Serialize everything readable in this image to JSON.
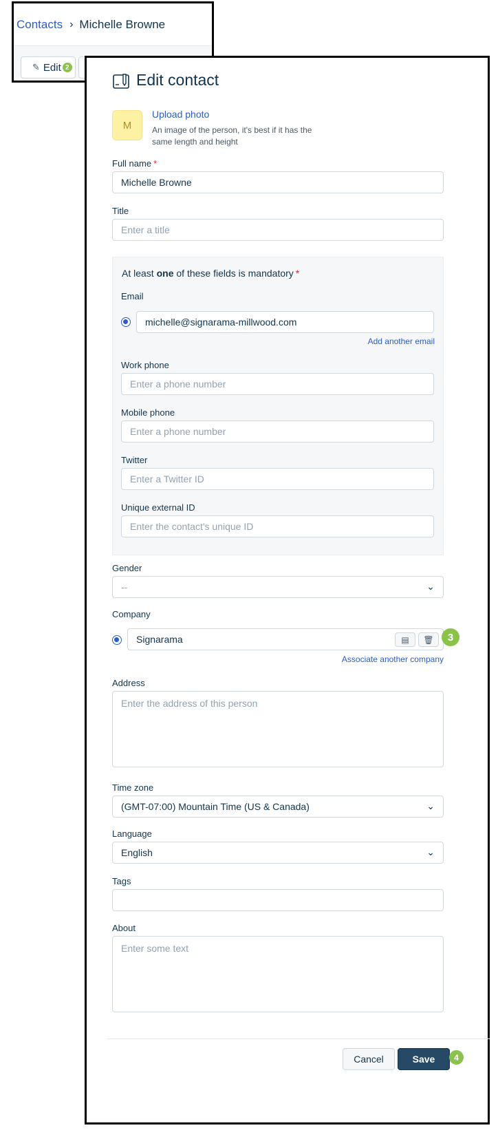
{
  "breadcrumb": {
    "parent": "Contacts",
    "separator": "›",
    "current": "Michelle Browne"
  },
  "toolbar": {
    "edit_label": "Edit",
    "edit_badge": "2"
  },
  "form": {
    "title": "Edit contact",
    "avatar_initial": "M",
    "upload_label": "Upload photo",
    "upload_hint": "An image of the person, it's best if it has the same length and height",
    "full_name": {
      "label": "Full name",
      "required_mark": "*",
      "value": "Michelle Browne"
    },
    "title_field": {
      "label": "Title",
      "placeholder": "Enter a title"
    },
    "mandatory": {
      "text_before": "At least ",
      "text_bold": "one",
      "text_after": " of these fields is mandatory",
      "required_mark": "*"
    },
    "email": {
      "label": "Email",
      "value": "michelle@signarama-millwood.com",
      "add_link": "Add another email"
    },
    "work_phone": {
      "label": "Work phone",
      "placeholder": "Enter a phone number"
    },
    "mobile_phone": {
      "label": "Mobile phone",
      "placeholder": "Enter a phone number"
    },
    "twitter": {
      "label": "Twitter",
      "placeholder": "Enter a Twitter ID"
    },
    "external_id": {
      "label": "Unique external ID",
      "placeholder": "Enter the contact's unique ID"
    },
    "gender": {
      "label": "Gender",
      "value": "--"
    },
    "company": {
      "label": "Company",
      "value": "Signarama",
      "add_link": "Associate another company",
      "badge": "3"
    },
    "address": {
      "label": "Address",
      "placeholder": "Enter the address of this person"
    },
    "time_zone": {
      "label": "Time zone",
      "value": "(GMT-07:00) Mountain Time (US & Canada)"
    },
    "language": {
      "label": "Language",
      "value": "English"
    },
    "tags": {
      "label": "Tags",
      "value": ""
    },
    "about": {
      "label": "About",
      "placeholder": "Enter some text"
    }
  },
  "footer": {
    "cancel_label": "Cancel",
    "save_label": "Save",
    "save_badge": "4"
  },
  "colors": {
    "link": "#2c5cc5",
    "primary_button": "#264966",
    "badge": "#8bc34a",
    "required": "#d72d30"
  }
}
